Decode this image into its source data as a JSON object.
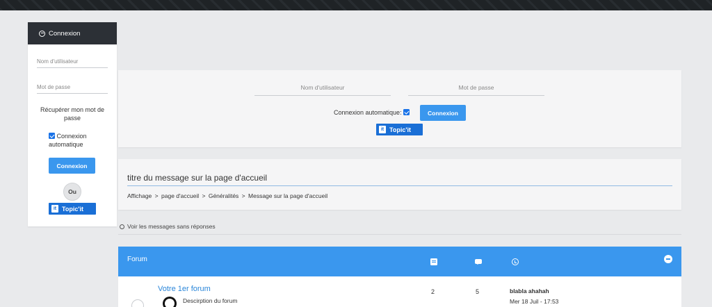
{
  "sidebar": {
    "title": "Connexion",
    "username_placeholder": "Nom d'utilisateur",
    "password_placeholder": "Mot de passe",
    "recover_link": "Récupérer mon mot de passe",
    "auto_login_label": "Connexion automatique",
    "auto_login_checked": true,
    "login_button": "Connexion",
    "or_label": "Ou",
    "topicit_label": "Topic'it"
  },
  "login_panel": {
    "username_placeholder": "Nom d'utilisateur",
    "password_placeholder": "Mot de passe",
    "auto_login_label": "Connexion automatique:",
    "auto_login_checked": true,
    "login_button": "Connexion",
    "topicit_label": "Topic'it"
  },
  "message": {
    "title": "titre du message sur la page d'accueil",
    "breadcrumb": [
      "Affichage",
      "page d'accueil",
      "Généralités",
      "Message sur la page d'accueil"
    ],
    "breadcrumb_separator": ">"
  },
  "unanswered_link": "Voir les messages sans réponses",
  "forum_table": {
    "header_label": "Forum",
    "header_icons": [
      "topics-icon",
      "posts-icon",
      "clock-icon",
      "collapse-icon"
    ],
    "accent_color": "#3a97ee",
    "rows": [
      {
        "name": "Votre 1er forum",
        "description": "Descirption du forum",
        "topics": "2",
        "posts": "5",
        "last_post_title": "blabla ahahah",
        "last_post_date": "Mer 18 Juil - 17:53"
      }
    ]
  }
}
